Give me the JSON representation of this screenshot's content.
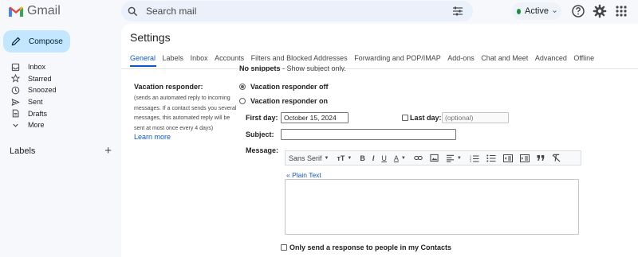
{
  "app": {
    "name": "Gmail"
  },
  "search": {
    "placeholder": "Search mail"
  },
  "status": {
    "label": "Active",
    "color": "#1e8e3e"
  },
  "header_icons": [
    "search-options-icon",
    "help-icon",
    "settings-gear-icon",
    "apps-grid-icon"
  ],
  "sidebar": {
    "compose_label": "Compose",
    "items": [
      {
        "label": "Inbox",
        "icon": "inbox-icon"
      },
      {
        "label": "Starred",
        "icon": "star-icon"
      },
      {
        "label": "Snoozed",
        "icon": "clock-icon"
      },
      {
        "label": "Sent",
        "icon": "send-icon"
      },
      {
        "label": "Drafts",
        "icon": "draft-icon"
      },
      {
        "label": "More",
        "icon": "chevron-down-icon"
      }
    ],
    "labels_heading": "Labels",
    "add_label_symbol": "+"
  },
  "settings": {
    "title": "Settings",
    "tabs": [
      "General",
      "Labels",
      "Inbox",
      "Accounts",
      "Filters and Blocked Addresses",
      "Forwarding and POP/IMAP",
      "Add-ons",
      "Chat and Meet",
      "Advanced",
      "Offline"
    ],
    "active_tab": "General",
    "partial_row": {
      "strong": "No snippets",
      "rest": " - Show subject only."
    },
    "vacation": {
      "label": "Vacation responder:",
      "description": "(sends an automated reply to incoming messages. If a contact sends you several messages, this automated reply will be sent at most once every 4 days)",
      "learn_more": "Learn more",
      "option_off": "Vacation responder off",
      "option_on": "Vacation responder on",
      "selected": "off",
      "first_day_label": "First day:",
      "first_day_value": "October 15, 2024",
      "last_day_label": "Last day:",
      "last_day_placeholder": "(optional)",
      "subject_label": "Subject:",
      "subject_value": "",
      "message_label": "Message:",
      "toolbar": {
        "font": "Sans Serif",
        "size_symbol": "тT",
        "bold": "B",
        "italic": "I",
        "underline": "U",
        "text_color": "A"
      },
      "plain_text_link": "« Plain Text",
      "contacts_only_label": "Only send a response to people in my Contacts"
    }
  },
  "colors": {
    "accent": "#0b57d0",
    "compose_bg": "#c2e7ff",
    "page_bg": "#f6f8fc"
  }
}
